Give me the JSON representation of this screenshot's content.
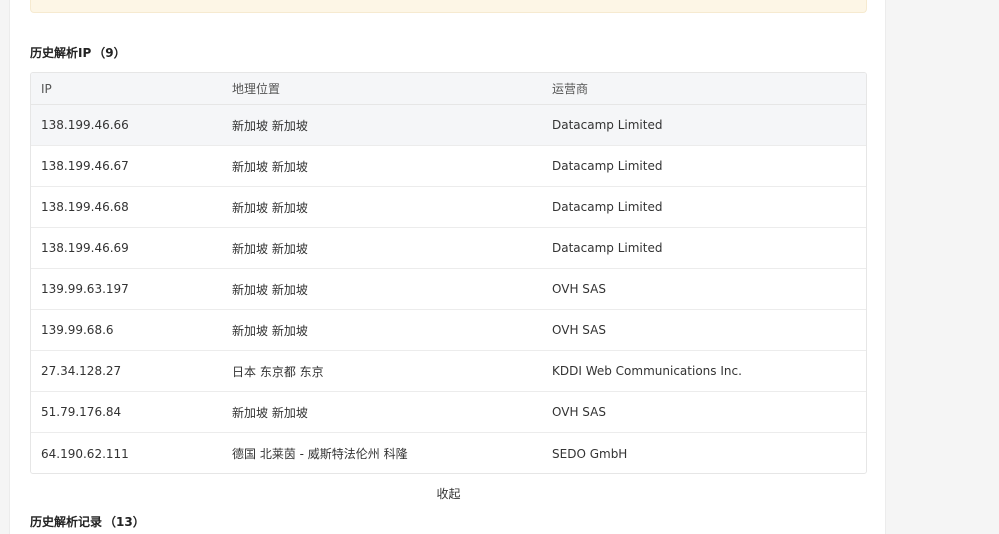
{
  "history_ip": {
    "title": "历史解析IP",
    "count": "（9）",
    "columns": {
      "ip": "IP",
      "location": "地理位置",
      "isp": "运营商"
    },
    "rows": [
      {
        "ip": "138.199.46.66",
        "location": "新加坡 新加坡",
        "isp": "Datacamp Limited"
      },
      {
        "ip": "138.199.46.67",
        "location": "新加坡 新加坡",
        "isp": "Datacamp Limited"
      },
      {
        "ip": "138.199.46.68",
        "location": "新加坡 新加坡",
        "isp": "Datacamp Limited"
      },
      {
        "ip": "138.199.46.69",
        "location": "新加坡 新加坡",
        "isp": "Datacamp Limited"
      },
      {
        "ip": "139.99.63.197",
        "location": "新加坡 新加坡",
        "isp": "OVH SAS"
      },
      {
        "ip": "139.99.68.6",
        "location": "新加坡 新加坡",
        "isp": "OVH SAS"
      },
      {
        "ip": "27.34.128.27",
        "location": "日本 东京都 东京",
        "isp": "KDDI Web Communications Inc."
      },
      {
        "ip": "51.79.176.84",
        "location": "新加坡 新加坡",
        "isp": "OVH SAS"
      },
      {
        "ip": "64.190.62.111",
        "location": "德国 北莱茵 - 威斯特法伦州 科隆",
        "isp": "SEDO GmbH"
      }
    ],
    "collapse_label": "收起"
  },
  "history_records": {
    "title": "历史解析记录",
    "count": "（13）"
  }
}
